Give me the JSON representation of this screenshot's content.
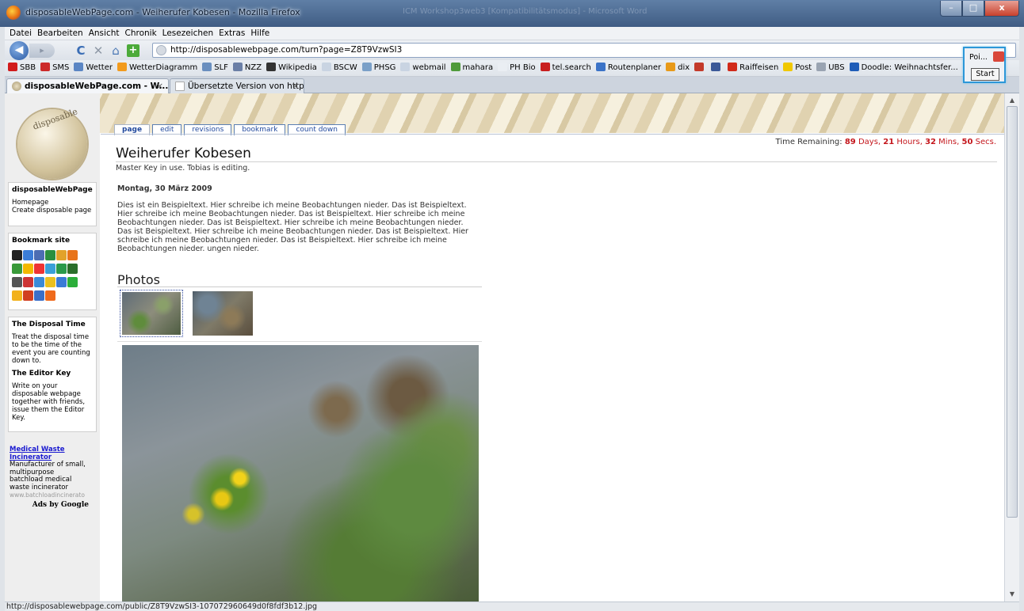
{
  "window": {
    "title": "disposableWebPage.com - Weiherufer Kobesen - Mozilla Firefox",
    "ghost_title": "ICM Workshop3web3 [Kompatibilitätsmodus] - Microsoft Word",
    "min": "–",
    "max": "□",
    "close": "x"
  },
  "menu": [
    "Datei",
    "Bearbeiten",
    "Ansicht",
    "Chronik",
    "Lesezeichen",
    "Extras",
    "Hilfe"
  ],
  "nav": {
    "url": "http://disposablewebpage.com/turn?page=Z8T9VzwSI3",
    "back_icon": "◀",
    "fwd_icon": "▸",
    "reload_icon": "C",
    "stop_icon": "✕",
    "home_icon": "⌂",
    "add_icon": "+"
  },
  "bookmarks": [
    {
      "label": "SBB",
      "color": "#d11b1b"
    },
    {
      "label": "SMS",
      "color": "#cc2a2a"
    },
    {
      "label": "Wetter",
      "color": "#5b86c4"
    },
    {
      "label": "WetterDiagramm",
      "color": "#f29b1e"
    },
    {
      "label": "SLF",
      "color": "#6a8fbf"
    },
    {
      "label": "NZZ",
      "color": "#6b7fa6"
    },
    {
      "label": "Wikipedia",
      "color": "#333333"
    },
    {
      "label": "BSCW",
      "color": "#c9d4e2"
    },
    {
      "label": "PHSG",
      "color": "#7aa0c8"
    },
    {
      "label": "webmail",
      "color": "#c9d4e2"
    },
    {
      "label": "mahara",
      "color": "#4f9b3b"
    },
    {
      "label": "PH Bio",
      "color": "#eaeef3"
    },
    {
      "label": "tel.search",
      "color": "#c81e1e"
    },
    {
      "label": "Routenplaner",
      "color": "#3b73c7"
    },
    {
      "label": "dix",
      "color": "#e89a1a"
    },
    {
      "label": "",
      "color": "#c33a2a"
    },
    {
      "label": "",
      "color": "#3b5998"
    },
    {
      "label": "Raiffeisen",
      "color": "#d12a1a"
    },
    {
      "label": "Post",
      "color": "#f0c800"
    },
    {
      "label": "UBS",
      "color": "#9aa4b2"
    },
    {
      "label": "Doodle: Weihnachtsfer...",
      "color": "#1f5db8"
    }
  ],
  "tabs": [
    {
      "label": "disposableWebPage.com - W...",
      "close": "×"
    },
    {
      "label": "Übersetzte Version von http://di...",
      "close": "×"
    }
  ],
  "popup": {
    "label": "Poi...",
    "button": "Start"
  },
  "sidebar": {
    "logo_text": "disposable",
    "nav_title": "disposableWebPage",
    "links": [
      "Homepage",
      "Create disposable page"
    ],
    "bookmark_title": "Bookmark site",
    "info": [
      {
        "heading": "The Disposal Time",
        "text": "Treat the disposal time to be the time of the event you are counting down to."
      },
      {
        "heading": "The Editor Key",
        "text": "Write on your disposable webpage together with friends, issue them the Editor Key."
      }
    ],
    "ad": {
      "title": "Medical Waste Incinerator",
      "text": "Manufacturer of small, multipurpose batchload medical waste incinerator",
      "domain": "www.batchloadincinerato",
      "ads_by": "Ads by Google"
    }
  },
  "page_tabs": [
    "page",
    "edit",
    "revisions",
    "bookmark",
    "count down"
  ],
  "timer": {
    "prefix": "Time Remaining:",
    "days": "89",
    "days_label": "Days,",
    "hours": "21",
    "hours_label": "Hours,",
    "mins": "32",
    "mins_label": "Mins,",
    "secs": "50",
    "secs_label": "Secs."
  },
  "page": {
    "title": "Weiherufer Kobesen",
    "subtitle": "Master Key in use. Tobias is editing.",
    "date": "Montag, 30 März 2009",
    "body": "Dies ist ein Beispieltext. Hier schreibe ich meine Beobachtungen nieder. Das ist Beispieltext. Hier schreibe ich meine Beobachtungen nieder. Das ist Beispieltext. Hier schreibe ich meine Beobachtungen nieder. Das ist Beispieltext. Hier schreibe ich meine Beobachtungen nieder. Das ist Beispieltext. Hier schreibe ich meine Beobachtungen nieder. Das ist Beispieltext. Hier schreibe ich meine Beobachtungen nieder. Das ist Beispieltext. Hier schreibe ich meine Beobachtungen nieder. ungen nieder.",
    "photos_heading": "Photos"
  },
  "status": "http://disposablewebpage.com/public/Z8T9VzwSI3-107072960649d0f8fdf3b12.jpg"
}
